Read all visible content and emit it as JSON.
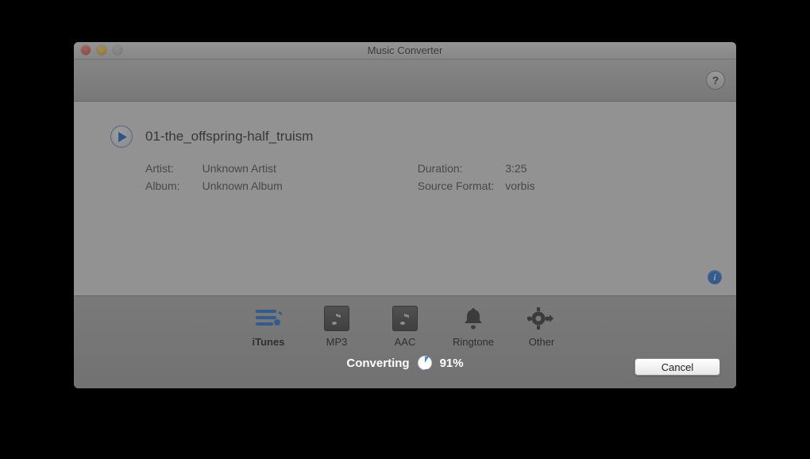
{
  "window": {
    "title": "Music Converter"
  },
  "track": {
    "filename": "01-the_offspring-half_truism",
    "artist_label": "Artist:",
    "artist_value": "Unknown Artist",
    "album_label": "Album:",
    "album_value": "Unknown Album",
    "duration_label": "Duration:",
    "duration_value": "3:25",
    "source_format_label": "Source Format:",
    "source_format_value": "vorbis"
  },
  "formats": {
    "itunes": "iTunes",
    "mp3": "MP3",
    "aac": "AAC",
    "ringtone": "Ringtone",
    "other": "Other"
  },
  "status": {
    "label": "Converting",
    "percent": "91%",
    "progress": 91
  },
  "buttons": {
    "cancel": "Cancel",
    "help": "?"
  }
}
